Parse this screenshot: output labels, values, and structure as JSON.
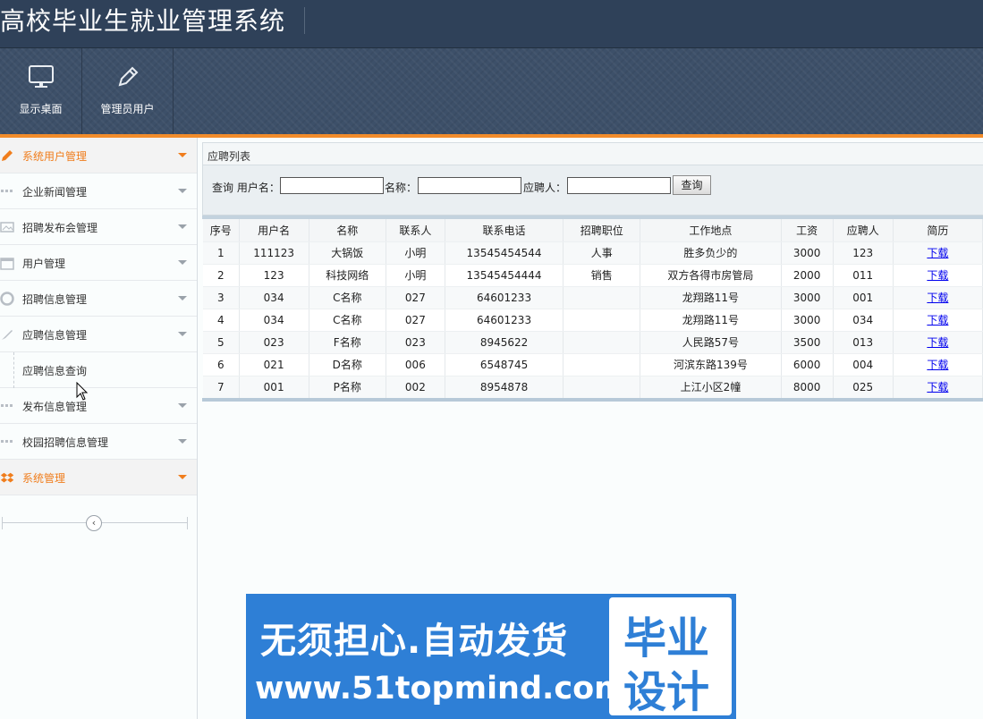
{
  "header": {
    "title": "高校毕业生就业管理系统"
  },
  "toolbar": {
    "items": [
      {
        "label": "显示桌面",
        "icon": "monitor-icon"
      },
      {
        "label": "管理员用户",
        "icon": "pencil-icon"
      }
    ]
  },
  "sidebar": {
    "items": [
      {
        "label": "系统用户管理",
        "icon": "pencil-icon",
        "active": true
      },
      {
        "label": "企业新闻管理",
        "icon": "grid-icon"
      },
      {
        "label": "招聘发布会管理",
        "icon": "image-icon"
      },
      {
        "label": "用户管理",
        "icon": "calendar-icon"
      },
      {
        "label": "招聘信息管理",
        "icon": "lifebuoy-icon"
      },
      {
        "label": "应聘信息管理",
        "icon": "brush-icon"
      },
      {
        "label": "发布信息管理",
        "icon": "grid-icon"
      },
      {
        "label": "校园招聘信息管理",
        "icon": "grid-icon"
      },
      {
        "label": "系统管理",
        "icon": "dropbox-icon",
        "active": true
      }
    ],
    "subitem": {
      "label": "应聘信息查询"
    },
    "collapse_symbol": "‹"
  },
  "panel": {
    "title": "应聘列表",
    "search": {
      "prefix_label": "查询 用户名：",
      "name_label": "名称：",
      "applicant_label": "应聘人：",
      "username_value": "",
      "name_value": "",
      "applicant_value": "",
      "button_label": "查询"
    }
  },
  "table": {
    "headers": [
      "序号",
      "用户名",
      "名称",
      "联系人",
      "联系电话",
      "招聘职位",
      "工作地点",
      "工资",
      "应聘人",
      "简历"
    ],
    "rows": [
      [
        "1",
        "111123",
        "大锅饭",
        "小明",
        "13545454544",
        "人事",
        "胜多负少的",
        "3000",
        "123",
        "下载"
      ],
      [
        "2",
        "123",
        "科技网络",
        "小明",
        "13545454444",
        "销售",
        "双方各得市房管局",
        "2000",
        "011",
        "下载"
      ],
      [
        "3",
        "034",
        "C名称",
        "027",
        "64601233",
        "",
        "龙翔路11号",
        "3000",
        "001",
        "下载"
      ],
      [
        "4",
        "034",
        "C名称",
        "027",
        "64601233",
        "",
        "龙翔路11号",
        "3000",
        "034",
        "下载"
      ],
      [
        "5",
        "023",
        "F名称",
        "023",
        "8945622",
        "",
        "人民路57号",
        "3500",
        "013",
        "下载"
      ],
      [
        "6",
        "021",
        "D名称",
        "006",
        "6548745",
        "",
        "河滨东路139号",
        "6000",
        "004",
        "下载"
      ],
      [
        "7",
        "001",
        "P名称",
        "002",
        "8954878",
        "",
        "上江小区2幢",
        "8000",
        "025",
        "下载"
      ]
    ]
  },
  "banner": {
    "line1": "无须担心.自动发货",
    "line2": "www.51topmind.com",
    "right_top": "毕业",
    "right_bottom": "设计"
  },
  "colors": {
    "header_bg": "#2f4159",
    "accent_orange": "#f28c2b",
    "link_blue": "#0000ee",
    "banner_blue": "#2e7fd6"
  }
}
